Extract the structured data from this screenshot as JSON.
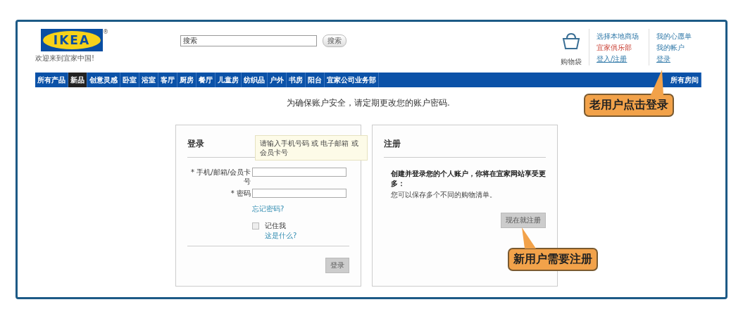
{
  "header": {
    "logo": {
      "text": "IKEA",
      "mark": "®"
    },
    "welcome": "欢迎来到宜家中国!",
    "search": {
      "value": "搜索",
      "button": "搜索"
    },
    "cart": {
      "label": "购物袋"
    },
    "link_groups": [
      [
        {
          "label": "选择本地商场",
          "kind": "link"
        },
        {
          "label": "宜家俱乐部",
          "kind": "promo"
        },
        {
          "label": "登入/注册",
          "kind": "underlined"
        }
      ],
      [
        {
          "label": "我的心愿单",
          "kind": "link"
        },
        {
          "label": "我的帐户",
          "kind": "link"
        },
        {
          "label": "登录",
          "kind": "underlined"
        }
      ]
    ],
    "callout": "老用户点击登录"
  },
  "nav": {
    "items": [
      {
        "label": "所有产品",
        "selected": false
      },
      {
        "label": "新品",
        "selected": true
      },
      {
        "label": "创意灵感",
        "selected": false
      },
      {
        "label": "卧室",
        "selected": false
      },
      {
        "label": "浴室",
        "selected": false
      },
      {
        "label": "客厅",
        "selected": false
      },
      {
        "label": "厨房",
        "selected": false
      },
      {
        "label": "餐厅",
        "selected": false
      },
      {
        "label": "儿童房",
        "selected": false
      },
      {
        "label": "纺织品",
        "selected": false
      },
      {
        "label": "户外",
        "selected": false
      },
      {
        "label": "书房",
        "selected": false
      },
      {
        "label": "阳台",
        "selected": false
      },
      {
        "label": "宜家公司业务部",
        "selected": false
      }
    ],
    "right": "所有房间"
  },
  "notice": "为确保账户安全，请定期更改您的账户密码.",
  "login": {
    "title": "登录",
    "tooltip": "请输入手机号码 或 电子邮箱 或会员卡号",
    "fields": [
      {
        "label": "* 手机/邮箱/会员卡号"
      },
      {
        "label": "* 密码"
      }
    ],
    "forgot": "忘记密码?",
    "remember": {
      "label": "记住我",
      "checked": false
    },
    "what": "这是什么?",
    "button": "登录"
  },
  "register": {
    "title": "注册",
    "lead": "创建并登录您的个人账户，你将在宜家网站享受更多：",
    "text": "您可以保存多个不同的购物清单。",
    "button": "现在就注册",
    "callout": "新用户需要注册"
  }
}
